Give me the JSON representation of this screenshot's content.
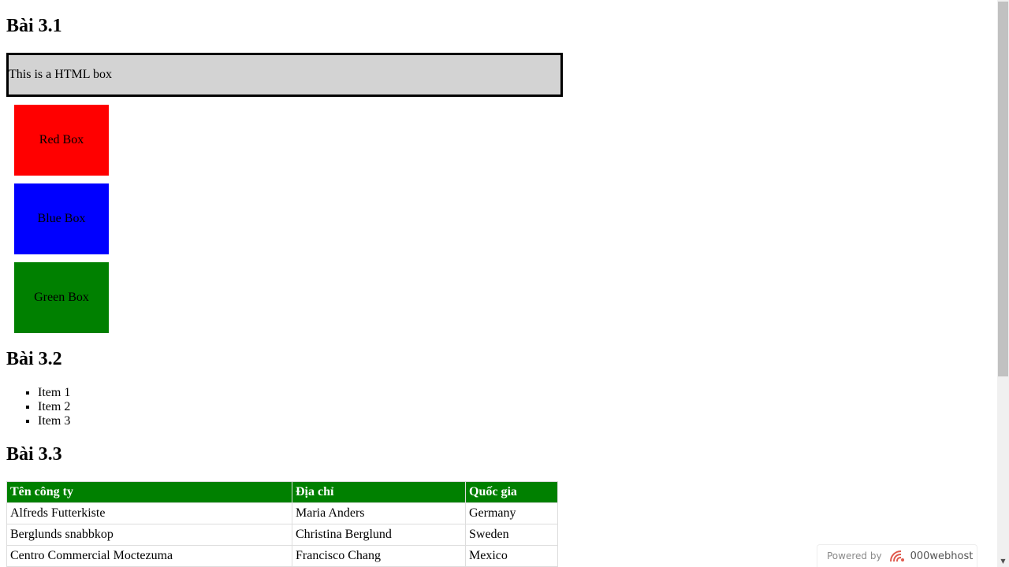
{
  "bai31": {
    "title": "Bài 3.1",
    "html_box_text": "This is a HTML box",
    "boxes": [
      {
        "label": "Red Box",
        "color": "#ff0000"
      },
      {
        "label": "Blue Box",
        "color": "#0000ff"
      },
      {
        "label": "Green Box",
        "color": "#008000"
      }
    ]
  },
  "bai32": {
    "title": "Bài 3.2",
    "items": [
      "Item 1",
      "Item 2",
      "Item 3"
    ]
  },
  "bai33": {
    "title": "Bài 3.3",
    "headers": [
      "Tên công ty",
      "Địa chỉ",
      "Quốc gia"
    ],
    "header_color": "#008000",
    "rows": [
      [
        "Alfreds Futterkiste",
        "Maria Anders",
        "Germany"
      ],
      [
        "Berglunds snabbkop",
        "Christina Berglund",
        "Sweden"
      ],
      [
        "Centro Commercial Moctezuma",
        "Francisco Chang",
        "Mexico"
      ]
    ]
  },
  "badge": {
    "powered_by": "Powered by",
    "brand": "000webhost",
    "icon": "000webhost-logo-icon"
  }
}
